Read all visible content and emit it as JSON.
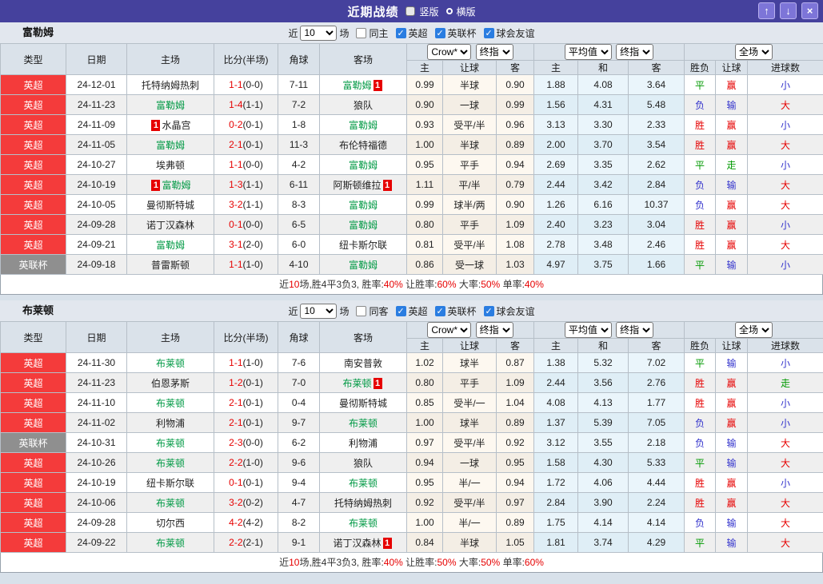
{
  "colors": {
    "topbar_purple": "#45419d",
    "topbar_button": "#7d75d8",
    "league_red": "#f43b3b",
    "league_gray": "#8f8f8f",
    "team_green": "#009944",
    "score_red": "#e60000",
    "win_red": "#e60000",
    "draw_green": "#009900",
    "lose_blue": "#3333cc",
    "checkbox_blue": "#2a7de1",
    "handicap_col_bg": "#fdf8f0",
    "average_col_bg": "#eaf5fb"
  },
  "icons": {
    "up_arrow": "↑",
    "down_arrow": "↓",
    "close": "×"
  },
  "titlebar": {
    "title": "近期战绩",
    "radios": [
      {
        "label": "竖版",
        "selected": true
      },
      {
        "label": "横版",
        "selected": false
      }
    ]
  },
  "table": {
    "headers": {
      "type": "类型",
      "date": "日期",
      "home": "主场",
      "score": "比分(半场)",
      "corner": "角球",
      "away": "客场",
      "h_home": "主",
      "h_line": "让球",
      "h_away": "客",
      "a_home": "主",
      "a_draw": "和",
      "a_away": "客",
      "r_wdl": "胜负",
      "r_handicap": "让球",
      "r_goals": "进球数"
    },
    "dropdowns": {
      "company": "Crow*",
      "stage1": "终指",
      "average": "平均值",
      "stage2": "终指",
      "scope": "全场"
    }
  },
  "sections": [
    {
      "team": "富勒姆",
      "filter": {
        "near_label": "近",
        "games_value": "10",
        "games_label": "场",
        "same_checked": false,
        "same_label": "同主",
        "leagues": [
          "英超",
          "英联杯",
          "球会友谊"
        ],
        "leagues_checked": [
          true,
          true,
          true
        ]
      },
      "rows": [
        {
          "lg": "英超",
          "lgc": "red",
          "date": "24-12-01",
          "home": {
            "name": "托特纳姆热刺",
            "green": false
          },
          "score": "1-1",
          "half": "(0-0)",
          "corner": "7-11",
          "away": {
            "name": "富勒姆",
            "green": true,
            "badge": "1"
          },
          "odds": [
            "0.99",
            "半球",
            "0.90"
          ],
          "avg": [
            "1.88",
            "4.08",
            "3.64"
          ],
          "res": [
            "平",
            "赢",
            "小"
          ]
        },
        {
          "lg": "英超",
          "lgc": "red",
          "date": "24-11-23",
          "home": {
            "name": "富勒姆",
            "green": true
          },
          "score": "1-4",
          "half": "(1-1)",
          "corner": "7-2",
          "away": {
            "name": "狼队",
            "green": false
          },
          "odds": [
            "0.90",
            "一球",
            "0.99"
          ],
          "avg": [
            "1.56",
            "4.31",
            "5.48"
          ],
          "res": [
            "负",
            "输",
            "大"
          ]
        },
        {
          "lg": "英超",
          "lgc": "red",
          "date": "24-11-09",
          "home": {
            "name": "水晶宫",
            "green": false,
            "badge": "1"
          },
          "score": "0-2",
          "half": "(0-1)",
          "corner": "1-8",
          "away": {
            "name": "富勒姆",
            "green": true
          },
          "odds": [
            "0.93",
            "受平/半",
            "0.96"
          ],
          "avg": [
            "3.13",
            "3.30",
            "2.33"
          ],
          "res": [
            "胜",
            "赢",
            "小"
          ]
        },
        {
          "lg": "英超",
          "lgc": "red",
          "date": "24-11-05",
          "home": {
            "name": "富勒姆",
            "green": true
          },
          "score": "2-1",
          "half": "(0-1)",
          "corner": "11-3",
          "away": {
            "name": "布伦特福德",
            "green": false
          },
          "odds": [
            "1.00",
            "半球",
            "0.89"
          ],
          "avg": [
            "2.00",
            "3.70",
            "3.54"
          ],
          "res": [
            "胜",
            "赢",
            "大"
          ]
        },
        {
          "lg": "英超",
          "lgc": "red",
          "date": "24-10-27",
          "home": {
            "name": "埃弗顿",
            "green": false
          },
          "score": "1-1",
          "half": "(0-0)",
          "corner": "4-2",
          "away": {
            "name": "富勒姆",
            "green": true
          },
          "odds": [
            "0.95",
            "平手",
            "0.94"
          ],
          "avg": [
            "2.69",
            "3.35",
            "2.62"
          ],
          "res": [
            "平",
            "走",
            "小"
          ]
        },
        {
          "lg": "英超",
          "lgc": "red",
          "date": "24-10-19",
          "home": {
            "name": "富勒姆",
            "green": true,
            "badge": "1"
          },
          "score": "1-3",
          "half": "(1-1)",
          "corner": "6-11",
          "away": {
            "name": "阿斯顿维拉",
            "green": false,
            "badge": "1"
          },
          "odds": [
            "1.11",
            "平/半",
            "0.79"
          ],
          "avg": [
            "2.44",
            "3.42",
            "2.84"
          ],
          "res": [
            "负",
            "输",
            "大"
          ]
        },
        {
          "lg": "英超",
          "lgc": "red",
          "date": "24-10-05",
          "home": {
            "name": "曼彻斯特城",
            "green": false
          },
          "score": "3-2",
          "half": "(1-1)",
          "corner": "8-3",
          "away": {
            "name": "富勒姆",
            "green": true
          },
          "odds": [
            "0.99",
            "球半/两",
            "0.90"
          ],
          "avg": [
            "1.26",
            "6.16",
            "10.37"
          ],
          "res": [
            "负",
            "赢",
            "大"
          ]
        },
        {
          "lg": "英超",
          "lgc": "red",
          "date": "24-09-28",
          "home": {
            "name": "诺丁汉森林",
            "green": false
          },
          "score": "0-1",
          "half": "(0-0)",
          "corner": "6-5",
          "away": {
            "name": "富勒姆",
            "green": true
          },
          "odds": [
            "0.80",
            "平手",
            "1.09"
          ],
          "avg": [
            "2.40",
            "3.23",
            "3.04"
          ],
          "res": [
            "胜",
            "赢",
            "小"
          ]
        },
        {
          "lg": "英超",
          "lgc": "red",
          "date": "24-09-21",
          "home": {
            "name": "富勒姆",
            "green": true
          },
          "score": "3-1",
          "half": "(2-0)",
          "corner": "6-0",
          "away": {
            "name": "纽卡斯尔联",
            "green": false
          },
          "odds": [
            "0.81",
            "受平/半",
            "1.08"
          ],
          "avg": [
            "2.78",
            "3.48",
            "2.46"
          ],
          "res": [
            "胜",
            "赢",
            "大"
          ]
        },
        {
          "lg": "英联杯",
          "lgc": "gray",
          "date": "24-09-18",
          "home": {
            "name": "普雷斯顿",
            "green": false
          },
          "score": "1-1",
          "half": "(1-0)",
          "corner": "4-10",
          "away": {
            "name": "富勒姆",
            "green": true
          },
          "odds": [
            "0.86",
            "受一球",
            "1.03"
          ],
          "avg": [
            "4.97",
            "3.75",
            "1.66"
          ],
          "res": [
            "平",
            "输",
            "小"
          ]
        }
      ],
      "summary": [
        {
          "t": "近"
        },
        {
          "t": "10",
          "red": true
        },
        {
          "t": "场,胜4平3负3, 胜率:"
        },
        {
          "t": "40%",
          "red": true
        },
        {
          "t": " 让胜率:"
        },
        {
          "t": "60%",
          "red": true
        },
        {
          "t": " 大率:"
        },
        {
          "t": "50%",
          "red": true
        },
        {
          "t": " 单率:"
        },
        {
          "t": "40%",
          "red": true
        }
      ]
    },
    {
      "team": "布莱顿",
      "filter": {
        "near_label": "近",
        "games_value": "10",
        "games_label": "场",
        "same_checked": false,
        "same_label": "同客",
        "leagues": [
          "英超",
          "英联杯",
          "球会友谊"
        ],
        "leagues_checked": [
          true,
          true,
          true
        ]
      },
      "rows": [
        {
          "lg": "英超",
          "lgc": "red",
          "date": "24-11-30",
          "home": {
            "name": "布莱顿",
            "green": true
          },
          "score": "1-1",
          "half": "(1-0)",
          "corner": "7-6",
          "away": {
            "name": "南安普敦",
            "green": false
          },
          "odds": [
            "1.02",
            "球半",
            "0.87"
          ],
          "avg": [
            "1.38",
            "5.32",
            "7.02"
          ],
          "res": [
            "平",
            "输",
            "小"
          ]
        },
        {
          "lg": "英超",
          "lgc": "red",
          "date": "24-11-23",
          "home": {
            "name": "伯恩茅斯",
            "green": false
          },
          "score": "1-2",
          "half": "(0-1)",
          "corner": "7-0",
          "away": {
            "name": "布莱顿",
            "green": true,
            "badge": "1"
          },
          "odds": [
            "0.80",
            "平手",
            "1.09"
          ],
          "avg": [
            "2.44",
            "3.56",
            "2.76"
          ],
          "res": [
            "胜",
            "赢",
            "走"
          ]
        },
        {
          "lg": "英超",
          "lgc": "red",
          "date": "24-11-10",
          "home": {
            "name": "布莱顿",
            "green": true
          },
          "score": "2-1",
          "half": "(0-1)",
          "corner": "0-4",
          "away": {
            "name": "曼彻斯特城",
            "green": false
          },
          "odds": [
            "0.85",
            "受半/一",
            "1.04"
          ],
          "avg": [
            "4.08",
            "4.13",
            "1.77"
          ],
          "res": [
            "胜",
            "赢",
            "小"
          ]
        },
        {
          "lg": "英超",
          "lgc": "red",
          "date": "24-11-02",
          "home": {
            "name": "利物浦",
            "green": false
          },
          "score": "2-1",
          "half": "(0-1)",
          "corner": "9-7",
          "away": {
            "name": "布莱顿",
            "green": true
          },
          "odds": [
            "1.00",
            "球半",
            "0.89"
          ],
          "avg": [
            "1.37",
            "5.39",
            "7.05"
          ],
          "res": [
            "负",
            "赢",
            "小"
          ]
        },
        {
          "lg": "英联杯",
          "lgc": "gray",
          "date": "24-10-31",
          "home": {
            "name": "布莱顿",
            "green": true
          },
          "score": "2-3",
          "half": "(0-0)",
          "corner": "6-2",
          "away": {
            "name": "利物浦",
            "green": false
          },
          "odds": [
            "0.97",
            "受平/半",
            "0.92"
          ],
          "avg": [
            "3.12",
            "3.55",
            "2.18"
          ],
          "res": [
            "负",
            "输",
            "大"
          ]
        },
        {
          "lg": "英超",
          "lgc": "red",
          "date": "24-10-26",
          "home": {
            "name": "布莱顿",
            "green": true
          },
          "score": "2-2",
          "half": "(1-0)",
          "corner": "9-6",
          "away": {
            "name": "狼队",
            "green": false
          },
          "odds": [
            "0.94",
            "一球",
            "0.95"
          ],
          "avg": [
            "1.58",
            "4.30",
            "5.33"
          ],
          "res": [
            "平",
            "输",
            "大"
          ]
        },
        {
          "lg": "英超",
          "lgc": "red",
          "date": "24-10-19",
          "home": {
            "name": "纽卡斯尔联",
            "green": false
          },
          "score": "0-1",
          "half": "(0-1)",
          "corner": "9-4",
          "away": {
            "name": "布莱顿",
            "green": true
          },
          "odds": [
            "0.95",
            "半/一",
            "0.94"
          ],
          "avg": [
            "1.72",
            "4.06",
            "4.44"
          ],
          "res": [
            "胜",
            "赢",
            "小"
          ]
        },
        {
          "lg": "英超",
          "lgc": "red",
          "date": "24-10-06",
          "home": {
            "name": "布莱顿",
            "green": true
          },
          "score": "3-2",
          "half": "(0-2)",
          "corner": "4-7",
          "away": {
            "name": "托特纳姆热刺",
            "green": false
          },
          "odds": [
            "0.92",
            "受平/半",
            "0.97"
          ],
          "avg": [
            "2.84",
            "3.90",
            "2.24"
          ],
          "res": [
            "胜",
            "赢",
            "大"
          ]
        },
        {
          "lg": "英超",
          "lgc": "red",
          "date": "24-09-28",
          "home": {
            "name": "切尔西",
            "green": false
          },
          "score": "4-2",
          "half": "(4-2)",
          "corner": "8-2",
          "away": {
            "name": "布莱顿",
            "green": true
          },
          "odds": [
            "1.00",
            "半/一",
            "0.89"
          ],
          "avg": [
            "1.75",
            "4.14",
            "4.14"
          ],
          "res": [
            "负",
            "输",
            "大"
          ]
        },
        {
          "lg": "英超",
          "lgc": "red",
          "date": "24-09-22",
          "home": {
            "name": "布莱顿",
            "green": true
          },
          "score": "2-2",
          "half": "(2-1)",
          "corner": "9-1",
          "away": {
            "name": "诺丁汉森林",
            "green": false,
            "badge": "1"
          },
          "odds": [
            "0.84",
            "半球",
            "1.05"
          ],
          "avg": [
            "1.81",
            "3.74",
            "4.29"
          ],
          "res": [
            "平",
            "输",
            "大"
          ]
        }
      ],
      "summary": [
        {
          "t": "近"
        },
        {
          "t": "10",
          "red": true
        },
        {
          "t": "场,胜4平3负3, 胜率:"
        },
        {
          "t": "40%",
          "red": true
        },
        {
          "t": " 让胜率:"
        },
        {
          "t": "50%",
          "red": true
        },
        {
          "t": " 大率:"
        },
        {
          "t": "50%",
          "red": true
        },
        {
          "t": " 单率:"
        },
        {
          "t": "60%",
          "red": true
        }
      ]
    }
  ]
}
